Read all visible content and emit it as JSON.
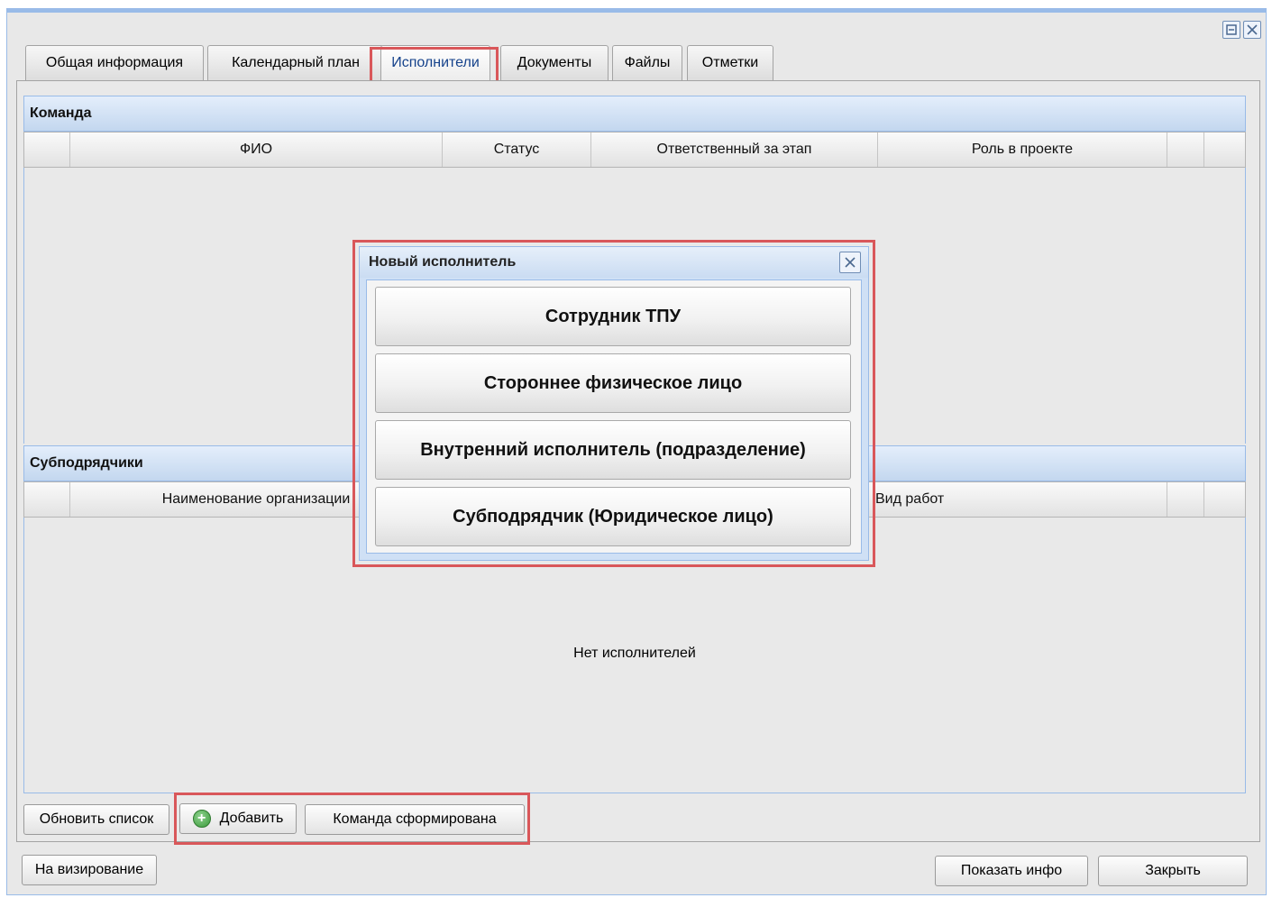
{
  "window": {
    "controls": {
      "restore_icon": "restore-icon",
      "close_icon": "close-icon"
    }
  },
  "tabs": [
    {
      "label": "Общая информация",
      "active": false
    },
    {
      "label": "Календарный план",
      "active": false
    },
    {
      "label": "Исполнители",
      "active": true
    },
    {
      "label": "Документы",
      "active": false
    },
    {
      "label": "Файлы",
      "active": false
    },
    {
      "label": "Отметки",
      "active": false
    }
  ],
  "team": {
    "title": "Команда",
    "columns": [
      "",
      "ФИО",
      "Статус",
      "Ответственный за этап",
      "Роль в проекте",
      "",
      ""
    ]
  },
  "subcontractors": {
    "title": "Субподрядчики",
    "columns": [
      "",
      "Наименование организации",
      "Вид работ",
      "",
      ""
    ],
    "empty_text": "Нет исполнителей"
  },
  "toolbar": {
    "refresh_label": "Обновить список",
    "add_label": "Добавить",
    "add_icon": "plus-circle-icon",
    "team_formed_label": "Команда сформирована"
  },
  "footer": {
    "approval_label": "На визирование",
    "show_info_label": "Показать инфо",
    "close_label": "Закрыть"
  },
  "dialog": {
    "title": "Новый исполнитель",
    "close_icon": "close-icon",
    "options": [
      "Сотрудник ТПУ",
      "Стороннее физическое лицо",
      "Внутренний исполнитель (подразделение)",
      "Субподрядчик (Юридическое лицо)"
    ]
  },
  "colors": {
    "highlight": "#d9575a",
    "header_blue": "#c3d7ef",
    "border_blue": "#99bbe8",
    "add_icon_green": "#3a9a3a"
  }
}
